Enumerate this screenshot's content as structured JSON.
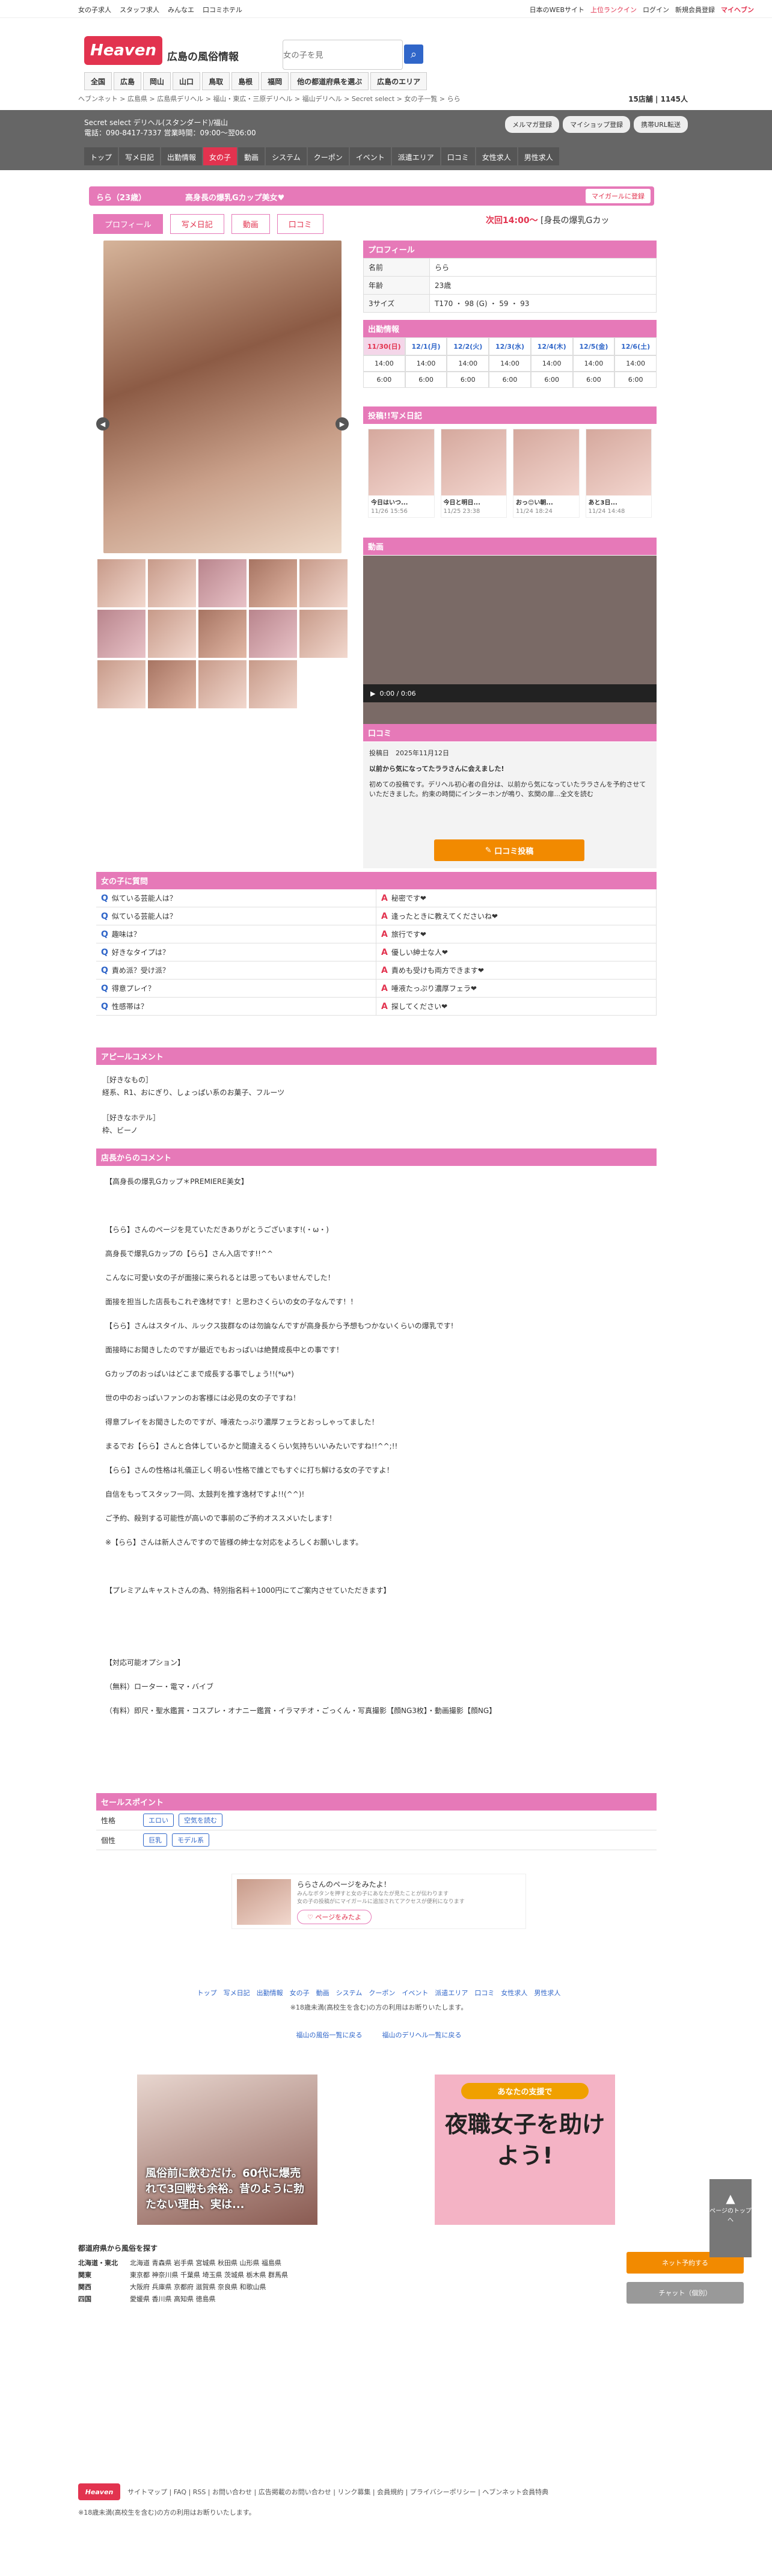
{
  "topbar": {
    "links": [
      "女の子求人",
      "スタッフ求人",
      "みんなエ",
      "口コミホテル"
    ],
    "right": [
      "日本のWEBサイト",
      "上位ランクイン",
      "ログイン",
      "新規会員登録",
      "マイヘブン"
    ]
  },
  "header": {
    "logo": "Heaven",
    "pref": "広島の風俗情報",
    "search_placeholder": "女の子を見"
  },
  "nav": [
    "全国",
    "広島",
    "岡山",
    "山口",
    "鳥取",
    "島根",
    "福岡",
    "他の都道府県を選ぶ",
    "広島のエリア"
  ],
  "breadcrumb": "ヘブンネット > 広島県 > 広島県デリヘル > 福山・東広・三原デリヘル > 福山デリヘル > Secret select > 女の子一覧 > らら",
  "counts": {
    "shops": "15",
    "shops_unit": "店舗",
    "girls": "1145",
    "girls_unit": "人"
  },
  "shop": {
    "name": "Secret select デリヘル(スタンダード)/福山",
    "tel": "電話：090-8417-7337 営業時間：09:00～翌06:00",
    "btns": [
      "メルマガ登録",
      "マイショップ登録",
      "携帯URL転送"
    ],
    "nav": [
      "トップ",
      "写メ日記",
      "出勤情報",
      "女の子",
      "動画",
      "システム",
      "クーポン",
      "イベント",
      "派遣エリア",
      "口コミ",
      "女性求人",
      "男性求人"
    ]
  },
  "girl": {
    "name": "らら（23歳）",
    "catch": "高身長の爆乳Gカップ美女♥",
    "mygirl": "マイガールに登録",
    "tabs": [
      "プロフィール",
      "写メ日記",
      "動画",
      "口コミ"
    ],
    "next_label": "次回14:00～",
    "next_text": "[身長の爆乳Gカッ"
  },
  "profile": {
    "title": "プロフィール",
    "rows": [
      {
        "k": "名前",
        "v": "らら"
      },
      {
        "k": "年齢",
        "v": "23歳"
      },
      {
        "k": "3サイズ",
        "v": "T170 ・ 98 (G) ・ 59 ・ 93"
      }
    ]
  },
  "schedule": {
    "title": "出勤情報",
    "days": [
      "11/30(日)",
      "12/1(月)",
      "12/2(火)",
      "12/3(水)",
      "12/4(木)",
      "12/5(金)",
      "12/6(土)"
    ],
    "start": [
      "14:00",
      "14:00",
      "14:00",
      "14:00",
      "14:00",
      "14:00",
      "14:00"
    ],
    "end": [
      "6:00",
      "6:00",
      "6:00",
      "6:00",
      "6:00",
      "6:00",
      "6:00"
    ]
  },
  "diary": {
    "title": "投稿!!写メ日記",
    "items": [
      {
        "t": "今日はいつ...",
        "d": "11/26 15:56"
      },
      {
        "t": "今日と明日...",
        "d": "11/25 23:38"
      },
      {
        "t": "おっ😊い朝...",
        "d": "11/24 18:24"
      },
      {
        "t": "あと3日...",
        "d": "11/24 14:48"
      }
    ]
  },
  "video": {
    "title": "動画",
    "time": "0:00 / 0:06"
  },
  "review": {
    "title": "口コミ",
    "date": "投稿日　2025年11月12日",
    "headline": "以前から気になってたララさんに会えました!",
    "body": "初めての投稿です。デリヘル初心者の自分は、以前から気になっていたララさんを予約させていただきました。約束の時間にインターホンが鳴り、玄関の扉...全文を読む",
    "btn": "口コミ投稿"
  },
  "qa": {
    "title": "女の子に質問",
    "rows": [
      {
        "q": "似ている芸能人は？",
        "a": "秘密です❤"
      },
      {
        "q": "似ている芸能人は？",
        "a": "逢ったときに教えてくださいね❤"
      },
      {
        "q": "趣味は？",
        "a": "旅行です❤"
      },
      {
        "q": "好きなタイプは？",
        "a": "優しい紳士な人❤"
      },
      {
        "q": "責め派？受け派？",
        "a": "責めも受けも両方できます❤"
      },
      {
        "q": "得意プレイ？",
        "a": "唾液たっぷり濃厚フェラ❤"
      },
      {
        "q": "性感帯は？",
        "a": "探してください❤"
      }
    ]
  },
  "appeal": {
    "title": "アピールコメント",
    "body": "［好きなもの］\n経系、R1、おにぎり、しょっぱい系のお菓子、フルーツ\n\n［好きなホテル］\n枠、ビーノ"
  },
  "shopcomment": {
    "title": "店長からのコメント",
    "body": "【高身長の爆乳Gカップ＊PREMIERE美女】\n\n【らら】さんのページを見ていただきありがとうございます!(・ω・)\n高身長で爆乳Gカップの【らら】さん入店です!!^^\nこんなに可愛い女の子が面接に来られるとは思ってもいませんでした！\n面接を担当した店長もこれぞ逸材です！と思わさくらいの女の子なんです！！\n【らら】さんはスタイル、ルックス抜群なのは勿論なんですが高身長から予想もつかないくらいの爆乳です!\n面接時にお聞きしたのですが最近でもおっぱいは絶賛成長中との事です！\nGカップのおっぱいはどこまで成長する事でしょう!!(*ω*)\n世の中のおっぱいファンのお客様には必見の女の子ですね！\n得意プレイをお聞きしたのですが、唾液たっぷり濃厚フェラとおっしゃってました！\nまるでお【らら】さんと合体しているかと間違えるくらい気持ちいいみたいですね!!^^;!!\n【らら】さんの性格は礼儀正しく明るい性格で誰とでもすぐに打ち解ける女の子ですよ！\n自信をもってスタッフ一同、太鼓判を推す逸材ですよ!!(^^)!\nご予約、殺到する可能性が高いので事前のご予約オススメいたします！\n※【らら】さんは新人さんですので皆様の紳士な対応をよろしくお願いします。\n\n【プレミアムキャストさんの為、特別指名料＋1000円にてご案内させていただきます】\n\n\n【対応可能オプション】\n（無料）ローター・電マ・バイブ\n（有料）即尺・聖水鑑賞・コスプレ・オナニー鑑賞・イラマチオ・ごっくん・写真撮影【顔NG3枚】・動画撮影【顔NG】"
  },
  "sales": {
    "title": "セールスポイント",
    "rows": [
      {
        "k": "性格",
        "tags": [
          "エロい",
          "空気を読む"
        ]
      },
      {
        "k": "個性",
        "tags": [
          "巨乳",
          "モデル系"
        ]
      }
    ]
  },
  "share": {
    "t": "ららさんのページをみたよ！",
    "d": "みんなボタンを押すと女の子にあなたが見たことが伝わります\n女の子の投稿がにマイガールに追加されてアクセスが便利になります",
    "btn": "ページをみたよ"
  },
  "footlinks": [
    "トップ",
    "写メ日記",
    "出勤情報",
    "女の子",
    "動画",
    "システム",
    "クーポン",
    "イベント",
    "派遣エリア",
    "口コミ",
    "女性求人",
    "男性求人"
  ],
  "footnote": "※18歳未満(高校生を含む)の方の利用はお断りいたします。",
  "footback": [
    "福山の風俗一覧に戻る",
    "福山のデリヘル一覧に戻る"
  ],
  "ad1": "風俗前に飲むだけ。60代に爆売れで3回戦も余裕。昔のように勃たない理由、実は...",
  "ad2": {
    "t": "あなたの支援で",
    "b": "夜職女子を助けよう!"
  },
  "region": {
    "title": "都道府県から風俗を探す",
    "rows": [
      {
        "k": "北海道・東北",
        "v": "北海道 青森県 岩手県 宮城県 秋田県 山形県 福島県"
      },
      {
        "k": "関東",
        "v": "東京都 神奈川県 千葉県 埼玉県 茨城県 栃木県 群馬県"
      },
      {
        "k": "関西",
        "v": "大阪府 兵庫県 京都府 滋賀県 奈良県 和歌山県"
      },
      {
        "k": "四国",
        "v": "愛媛県 香川県 高知県 徳島県"
      }
    ]
  },
  "sidebtns": [
    "ネット予約する",
    "チャット（個別）"
  ],
  "topbtn": "ページのトップへ",
  "footer": {
    "links": "サイトマップ | FAQ | RSS | お問い合わせ | 広告掲載のお問い合わせ | リンク募集 | 会員規約 | プライバシーポリシー | ヘブンネット会員特典",
    "copy": "※18歳未満(高校生を含む)の方の利用はお断りいたします。"
  }
}
